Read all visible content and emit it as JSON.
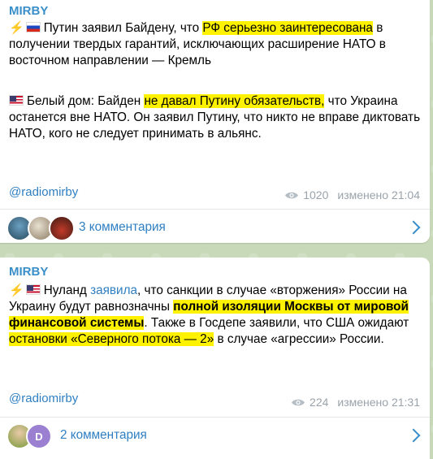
{
  "posts": [
    {
      "channel": "MIRBY",
      "block1": {
        "t1": "Путин заявил Байдену, что ",
        "h1": "РФ серьезно заинтересована",
        "t2": " в получении твердых гарантий, исключающих расширение НАТО в восточном направлении — Кремль"
      },
      "block2": {
        "t1": "Белый дом: Байден ",
        "h1": "не давал Путину обязательств,",
        "t2": " что Украина останется вне НАТО. Он заявил Путину, что никто не вправе диктовать НАТО, кого не следует принимать в альянс."
      },
      "tag": "@radiomirby",
      "views": "1020",
      "edited": "изменено 21:04",
      "comments_label": "3 комментария"
    },
    {
      "channel": "MIRBY",
      "block1": {
        "t1": "Нуланд ",
        "link": "заявила",
        "t2": ", что санкции в случае «вторжения» России на Украину будут равнозначны ",
        "h1": "полной изоляции Москвы от мировой финансовой системы",
        "t3": ". Также в Госдепе заявили, что США ожидают ",
        "h2": "остановки «Северного потока — 2»",
        "t4": " в случае «агрессии» России."
      },
      "tag": "@radiomirby",
      "views": "224",
      "edited": "изменено 21:31",
      "comments_label": "2 комментария",
      "avatar_letter": "D"
    }
  ],
  "colors": {
    "accent": "#3a8fc9",
    "highlight": "#fff200",
    "meta": "#9aa3ab"
  },
  "icons": [
    "lightning-icon",
    "russia-flag-icon",
    "usa-flag-icon",
    "eye-icon",
    "chevron-right-icon"
  ]
}
